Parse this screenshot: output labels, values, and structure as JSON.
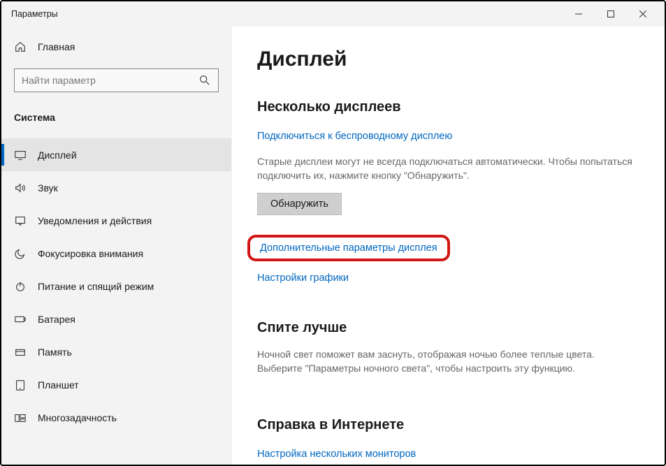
{
  "titlebar": {
    "title": "Параметры"
  },
  "sidebar": {
    "home": "Главная",
    "search_placeholder": "Найти параметр",
    "category": "Система",
    "items": [
      {
        "label": "Дисплей"
      },
      {
        "label": "Звук"
      },
      {
        "label": "Уведомления и действия"
      },
      {
        "label": "Фокусировка внимания"
      },
      {
        "label": "Питание и спящий режим"
      },
      {
        "label": "Батарея"
      },
      {
        "label": "Память"
      },
      {
        "label": "Планшет"
      },
      {
        "label": "Многозадачность"
      }
    ]
  },
  "main": {
    "heading": "Дисплей",
    "multi_displays": {
      "title": "Несколько дисплеев",
      "connect_link": "Подключиться к беспроводному дисплею",
      "old_text": "Старые дисплеи могут не всегда подключаться автоматически. Чтобы попытаться подключить их, нажмите кнопку \"Обнаружить\".",
      "detect_btn": "Обнаружить",
      "advanced_link": "Дополнительные параметры дисплея",
      "graphics_link": "Настройки графики"
    },
    "sleep_better": {
      "title": "Спите лучше",
      "text": "Ночной свет поможет вам заснуть, отображая ночью более теплые цвета. Выберите \"Параметры ночного света\", чтобы настроить эту функцию."
    },
    "help": {
      "title": "Справка в Интернете",
      "link": "Настройка нескольких мониторов"
    }
  }
}
